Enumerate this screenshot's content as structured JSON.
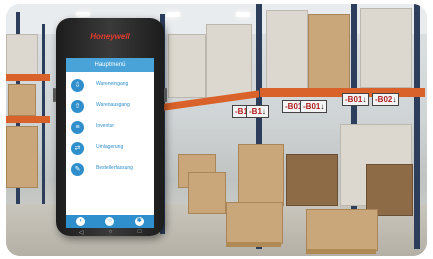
{
  "device": {
    "brand": "Honeywell",
    "screen_title": "Hauptmenü",
    "menu_items": [
      {
        "label": "Wareneingang",
        "icon": "inbox-icon"
      },
      {
        "label": "Warenausgang",
        "icon": "outbox-icon"
      },
      {
        "label": "Inventur",
        "icon": "clipboard-icon"
      },
      {
        "label": "Umlagerung",
        "icon": "transfer-icon"
      },
      {
        "label": "Bestellerfassung",
        "icon": "order-icon"
      }
    ],
    "nav": [
      "back-icon",
      "home-icon",
      "settings-icon"
    ]
  },
  "warehouse_labels": [
    {
      "text": "-B01",
      "arrow": "↓"
    },
    {
      "text": "-B02",
      "arrow": "↓"
    },
    {
      "text": "-B01",
      "arrow": "↓"
    },
    {
      "text": "-B01",
      "arrow": "↓"
    },
    {
      "text": "-B1",
      "arrow": "↓"
    },
    {
      "text": "-B1",
      "arrow": "↓"
    }
  ],
  "colors": {
    "accent": "#2f8fcc",
    "header": "#4aa3d8",
    "rack_beam": "#d9612a",
    "brand": "#e23b2e"
  }
}
